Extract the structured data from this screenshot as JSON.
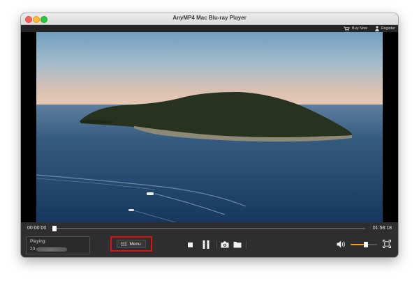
{
  "window": {
    "title": "AnyMP4 Mac Blu-ray Player"
  },
  "topbar": {
    "buy_now": "Buy Now",
    "register": "Register"
  },
  "player": {
    "current_time": "00:00:00",
    "total_time": "01:58:18",
    "progress": 0.0,
    "playing_label": "Playing:",
    "playing_value": "20",
    "volume": 0.58
  },
  "controls": {
    "menu_label": "Menu"
  },
  "colors": {
    "accent": "#f0a020",
    "highlight": "#e00f0f",
    "background": "#2e2e2e"
  },
  "icons": [
    "cart-icon",
    "person-icon",
    "grid-icon",
    "stop-icon",
    "pause-icon",
    "camera-icon",
    "folder-icon",
    "volume-icon",
    "fullscreen-icon"
  ]
}
